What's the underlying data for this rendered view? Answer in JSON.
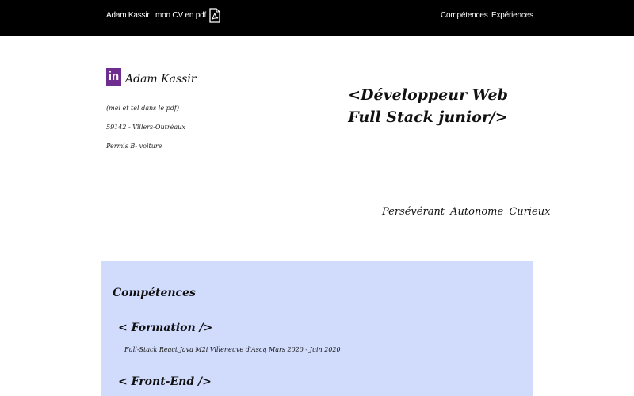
{
  "navbar": {
    "name_link": "Adam Kassir",
    "cv_link": "mon CV en pdf",
    "pdf_icon": "pdf-file-icon",
    "competences_link": "Compétences",
    "experiences_link": "Expériences",
    "background": "#000000"
  },
  "profile": {
    "linkedin_icon": "linkedin-icon",
    "linkedin_label": "in",
    "name": "Adam Kassir",
    "mail_note": "(mel et tel dans le pdf)",
    "city": "59142 - Villers-Outréaux",
    "permis": "Permis B- voiture"
  },
  "headline": {
    "title": "<Développeur Web Full Stack junior/>",
    "qualities": "Persévérant Autonome Curieux"
  },
  "skills": {
    "title": "Compétences",
    "formation_title": "< Formation />",
    "formation_item": "Full-Stack React Java M2i Villeneuve d'Ascq Mars 2020 - Juin 2020",
    "frontend_title": "< Front-End />",
    "background": "#d1dcfd"
  }
}
